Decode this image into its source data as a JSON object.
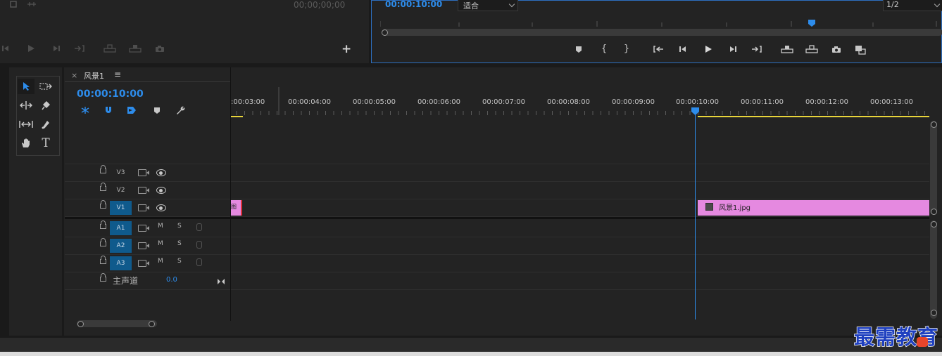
{
  "source_monitor": {
    "timecode": "00;00;00;00"
  },
  "program_monitor": {
    "timecode": "00:00:10:00",
    "fit_label": "适合",
    "resolution_label": "1/2"
  },
  "timeline": {
    "tab_close": "×",
    "sequence_name": "风景1",
    "menu_glyph": "≡",
    "timecode": "00:00:10:00",
    "ruler_labels": [
      ":00:03:00",
      "00:00:04:00",
      "00:00:05:00",
      "00:00:06:00",
      "00:00:07:00",
      "00:00:08:00",
      "00:00:09:00",
      "00:00:10:00",
      "00:00:11:00",
      "00:00:12:00",
      "00:00:13:00"
    ],
    "video_tracks": [
      "V3",
      "V2",
      "V1"
    ],
    "audio_tracks": [
      "A1",
      "A2",
      "A3"
    ],
    "mute_label": "M",
    "solo_label": "S",
    "master_label": "主声道",
    "master_value": "0.0",
    "clip_right_name": "风景1.jpg",
    "clip_left_fragment": "图"
  },
  "watermark": {
    "text": "最需教育"
  },
  "colors": {
    "accent_blue": "#2d8ceb",
    "clip_pink": "#e589e0",
    "work_area_yellow": "#e8d43a",
    "track_target_blue": "#0f5a8c"
  }
}
